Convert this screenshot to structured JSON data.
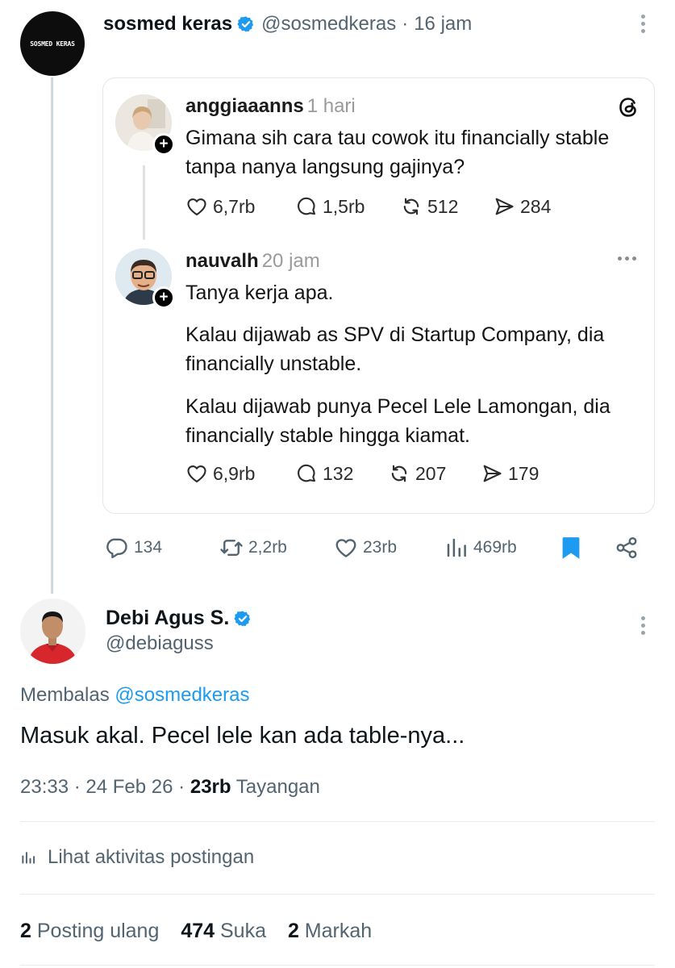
{
  "main_tweet": {
    "avatar_text": "SOSMED KERAS",
    "display_name": "sosmed keras",
    "handle": "@sosmedkeras",
    "separator": "·",
    "time": "16 jam",
    "actions": {
      "replies": "134",
      "reposts": "2,2rb",
      "likes": "23rb",
      "views": "469rb"
    }
  },
  "threads_card": {
    "post1": {
      "username": "anggiaaanns",
      "time": "1 hari",
      "text": "Gimana sih cara tau cowok itu financially stable tanpa nanya langsung gajinya?",
      "likes": "6,7rb",
      "replies": "1,5rb",
      "reposts": "512",
      "shares": "284"
    },
    "post2": {
      "username": "nauvalh",
      "time": "20 jam",
      "paragraph1": "Tanya kerja apa.",
      "paragraph2": "Kalau dijawab as SPV di Startup Company, dia financially unstable.",
      "paragraph3": "Kalau dijawab punya Pecel Lele Lamongan, dia financially stable hingga kiamat.",
      "likes": "6,9rb",
      "replies": "132",
      "reposts": "207",
      "shares": "179"
    }
  },
  "reply_tweet": {
    "display_name": "Debi Agus S.",
    "handle": "@debiaguss",
    "replying_to_label": "Membalas",
    "replying_to_handle": "@sosmedkeras",
    "text": "Masuk akal. Pecel lele kan ada table-nya...",
    "time": "23:33",
    "date": "24 Feb 26",
    "separator": "·",
    "views_count": "23rb",
    "views_label": "Tayangan",
    "activity_label": "Lihat aktivitas postingan",
    "reposts_count": "2",
    "reposts_label": "Posting ulang",
    "likes_count": "474",
    "likes_label": "Suka",
    "bookmarks_count": "2",
    "bookmarks_label": "Markah"
  },
  "colors": {
    "verified": "#1d9bf0",
    "link": "#1d9bf0",
    "bookmark": "#1d9bf0",
    "secondary_text": "#536471"
  }
}
